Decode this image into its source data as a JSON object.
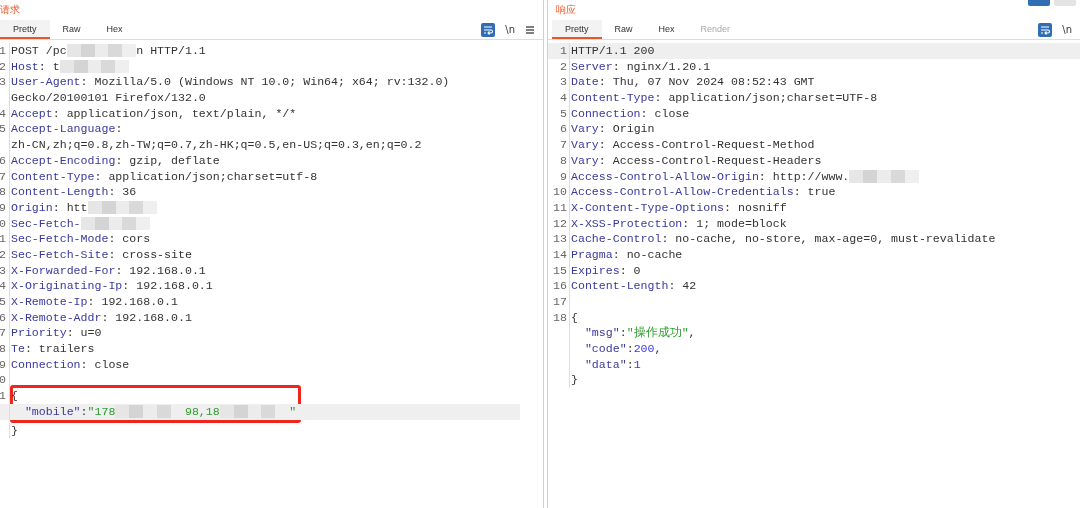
{
  "request": {
    "title": "请求",
    "tabs": [
      {
        "label": "Pretty",
        "selected": true,
        "disabled": false
      },
      {
        "label": "Raw",
        "selected": false,
        "disabled": false
      },
      {
        "label": "Hex",
        "selected": false,
        "disabled": false
      }
    ],
    "tools": [
      {
        "kind": "wrap"
      },
      {
        "kind": "newline",
        "text": "\\n"
      },
      {
        "kind": "menu"
      }
    ],
    "lines": [
      {
        "number": "1",
        "parts": [
          {
            "kind": "text",
            "text": "POST /pc"
          },
          {
            "kind": "redacted"
          },
          {
            "kind": "text",
            "text": "n HTTP/1.1"
          }
        ]
      },
      {
        "number": "2",
        "parts": [
          {
            "kind": "key",
            "text": "Host"
          },
          {
            "kind": "text",
            "text": ": t"
          },
          {
            "kind": "redacted"
          }
        ]
      },
      {
        "number": "3",
        "parts": [
          {
            "kind": "key",
            "text": "User-Agent"
          },
          {
            "kind": "text",
            "text": ": Mozilla/5.0 (Windows NT 10.0; Win64; x64; rv:132.0)"
          }
        ]
      },
      {
        "parts": [
          {
            "kind": "text",
            "text": "Gecko/20100101 Firefox/132.0"
          }
        ]
      },
      {
        "number": "4",
        "parts": [
          {
            "kind": "key",
            "text": "Accept"
          },
          {
            "kind": "text",
            "text": ": application/json, text/plain, */*"
          }
        ]
      },
      {
        "number": "5",
        "parts": [
          {
            "kind": "key",
            "text": "Accept-Language"
          },
          {
            "kind": "text",
            "text": ":"
          }
        ]
      },
      {
        "parts": [
          {
            "kind": "text",
            "text": "zh-CN,zh;q=0.8,zh-TW;q=0.7,zh-HK;q=0.5,en-US;q=0.3,en;q=0.2"
          }
        ]
      },
      {
        "number": "6",
        "parts": [
          {
            "kind": "key",
            "text": "Accept-Encoding"
          },
          {
            "kind": "text",
            "text": ": gzip, deflate"
          }
        ]
      },
      {
        "number": "7",
        "parts": [
          {
            "kind": "key",
            "text": "Content-Type"
          },
          {
            "kind": "text",
            "text": ": application/json;charset=utf-8"
          }
        ]
      },
      {
        "number": "8",
        "parts": [
          {
            "kind": "key",
            "text": "Content-Length"
          },
          {
            "kind": "text",
            "text": ": 36"
          }
        ]
      },
      {
        "number": "9",
        "parts": [
          {
            "kind": "key",
            "text": "Origin"
          },
          {
            "kind": "text",
            "text": ": htt"
          },
          {
            "kind": "redacted"
          }
        ]
      },
      {
        "number": "0",
        "parts": [
          {
            "kind": "key",
            "text": "Sec-Fetch-"
          },
          {
            "kind": "redacted"
          }
        ]
      },
      {
        "number": "1",
        "parts": [
          {
            "kind": "key",
            "text": "Sec-Fetch-Mode"
          },
          {
            "kind": "text",
            "text": ": cors"
          }
        ]
      },
      {
        "number": "2",
        "parts": [
          {
            "kind": "key",
            "text": "Sec-Fetch-Site"
          },
          {
            "kind": "text",
            "text": ": cross-site"
          }
        ]
      },
      {
        "number": "3",
        "parts": [
          {
            "kind": "key",
            "text": "X-Forwarded-For"
          },
          {
            "kind": "text",
            "text": ": 192.168.0.1"
          }
        ]
      },
      {
        "number": "4",
        "parts": [
          {
            "kind": "key",
            "text": "X-Originating-Ip"
          },
          {
            "kind": "text",
            "text": ": 192.168.0.1"
          }
        ]
      },
      {
        "number": "5",
        "parts": [
          {
            "kind": "key",
            "text": "X-Remote-Ip"
          },
          {
            "kind": "text",
            "text": ": 192.168.0.1"
          }
        ]
      },
      {
        "number": "6",
        "parts": [
          {
            "kind": "key",
            "text": "X-Remote-Addr"
          },
          {
            "kind": "text",
            "text": ": 192.168.0.1"
          }
        ]
      },
      {
        "number": "7",
        "parts": [
          {
            "kind": "key",
            "text": "Priority"
          },
          {
            "kind": "text",
            "text": ": u=0"
          }
        ]
      },
      {
        "number": "8",
        "parts": [
          {
            "kind": "key",
            "text": "Te"
          },
          {
            "kind": "text",
            "text": ": trailers"
          }
        ]
      },
      {
        "number": "9",
        "parts": [
          {
            "kind": "key",
            "text": "Connection"
          },
          {
            "kind": "text",
            "text": ": close"
          }
        ]
      },
      {
        "number": "0"
      },
      {
        "number": "1",
        "boxed": true,
        "parts": [
          {
            "kind": "text",
            "text": "{"
          }
        ]
      },
      {
        "boxed": true,
        "highlighted": true,
        "indent": true,
        "parts": [
          {
            "kind": "key",
            "text": "\"mobile\""
          },
          {
            "kind": "text",
            "text": ":"
          },
          {
            "kind": "string",
            "text": "\"178"
          },
          {
            "kind": "redacted"
          },
          {
            "kind": "string",
            "text": "98,18"
          },
          {
            "kind": "redacted"
          },
          {
            "kind": "string",
            "text": "\""
          }
        ]
      },
      {
        "parts": [
          {
            "kind": "text",
            "text": "}"
          }
        ]
      }
    ]
  },
  "response": {
    "title": "响应",
    "view_buttons": [
      {
        "selected": true
      },
      {
        "selected": false
      }
    ],
    "tabs": [
      {
        "label": "Pretty",
        "selected": true,
        "disabled": false
      },
      {
        "label": "Raw",
        "selected": false,
        "disabled": false
      },
      {
        "label": "Hex",
        "selected": false,
        "disabled": false
      },
      {
        "label": "Render",
        "selected": false,
        "disabled": true
      }
    ],
    "tools": [
      {
        "kind": "wrap"
      },
      {
        "kind": "newline",
        "text": "\\n"
      }
    ],
    "lines": [
      {
        "number": "1",
        "highlighted": true,
        "parts": [
          {
            "kind": "text",
            "text": "HTTP/1.1 200"
          }
        ]
      },
      {
        "number": "2",
        "parts": [
          {
            "kind": "key",
            "text": "Server"
          },
          {
            "kind": "text",
            "text": ": nginx/1.20.1"
          }
        ]
      },
      {
        "number": "3",
        "parts": [
          {
            "kind": "key",
            "text": "Date"
          },
          {
            "kind": "text",
            "text": ": Thu, 07 Nov 2024 08:52:43 GMT"
          }
        ]
      },
      {
        "number": "4",
        "parts": [
          {
            "kind": "key",
            "text": "Content-Type"
          },
          {
            "kind": "text",
            "text": ": application/json;charset=UTF-8"
          }
        ]
      },
      {
        "number": "5",
        "parts": [
          {
            "kind": "key",
            "text": "Connection"
          },
          {
            "kind": "text",
            "text": ": close"
          }
        ]
      },
      {
        "number": "6",
        "parts": [
          {
            "kind": "key",
            "text": "Vary"
          },
          {
            "kind": "text",
            "text": ": Origin"
          }
        ]
      },
      {
        "number": "7",
        "parts": [
          {
            "kind": "key",
            "text": "Vary"
          },
          {
            "kind": "text",
            "text": ": Access-Control-Request-Method"
          }
        ]
      },
      {
        "number": "8",
        "parts": [
          {
            "kind": "key",
            "text": "Vary"
          },
          {
            "kind": "text",
            "text": ": Access-Control-Request-Headers"
          }
        ]
      },
      {
        "number": "9",
        "parts": [
          {
            "kind": "key",
            "text": "Access-Control-Allow-Origin"
          },
          {
            "kind": "text",
            "text": ": http://www."
          },
          {
            "kind": "redacted"
          }
        ]
      },
      {
        "number": "10",
        "parts": [
          {
            "kind": "key",
            "text": "Access-Control-Allow-Credentials"
          },
          {
            "kind": "text",
            "text": ": true"
          }
        ]
      },
      {
        "number": "11",
        "parts": [
          {
            "kind": "key",
            "text": "X-Content-Type-Options"
          },
          {
            "kind": "text",
            "text": ": nosniff"
          }
        ]
      },
      {
        "number": "12",
        "parts": [
          {
            "kind": "key",
            "text": "X-XSS-Protection"
          },
          {
            "kind": "text",
            "text": ": 1; mode=block"
          }
        ]
      },
      {
        "number": "13",
        "parts": [
          {
            "kind": "key",
            "text": "Cache-Control"
          },
          {
            "kind": "text",
            "text": ": no-cache, no-store, max-age=0, must-revalidate"
          }
        ]
      },
      {
        "number": "14",
        "parts": [
          {
            "kind": "key",
            "text": "Pragma"
          },
          {
            "kind": "text",
            "text": ": no-cache"
          }
        ]
      },
      {
        "number": "15",
        "parts": [
          {
            "kind": "key",
            "text": "Expires"
          },
          {
            "kind": "text",
            "text": ": 0"
          }
        ]
      },
      {
        "number": "16",
        "parts": [
          {
            "kind": "key",
            "text": "Content-Length"
          },
          {
            "kind": "text",
            "text": ": 42"
          }
        ]
      },
      {
        "number": "17"
      },
      {
        "number": "18",
        "parts": [
          {
            "kind": "text",
            "text": "{"
          }
        ]
      },
      {
        "indent": true,
        "parts": [
          {
            "kind": "key",
            "text": "\"msg\""
          },
          {
            "kind": "text",
            "text": ":"
          },
          {
            "kind": "string",
            "text": "\"操作成功\""
          },
          {
            "kind": "text",
            "text": ","
          }
        ]
      },
      {
        "indent": true,
        "parts": [
          {
            "kind": "key",
            "text": "\"code\""
          },
          {
            "kind": "text",
            "text": ":"
          },
          {
            "kind": "number",
            "text": "200"
          },
          {
            "kind": "text",
            "text": ","
          }
        ]
      },
      {
        "indent": true,
        "parts": [
          {
            "kind": "key",
            "text": "\"data\""
          },
          {
            "kind": "text",
            "text": ":"
          },
          {
            "kind": "number",
            "text": "1"
          }
        ]
      },
      {
        "parts": [
          {
            "kind": "text",
            "text": "}"
          }
        ]
      }
    ]
  }
}
